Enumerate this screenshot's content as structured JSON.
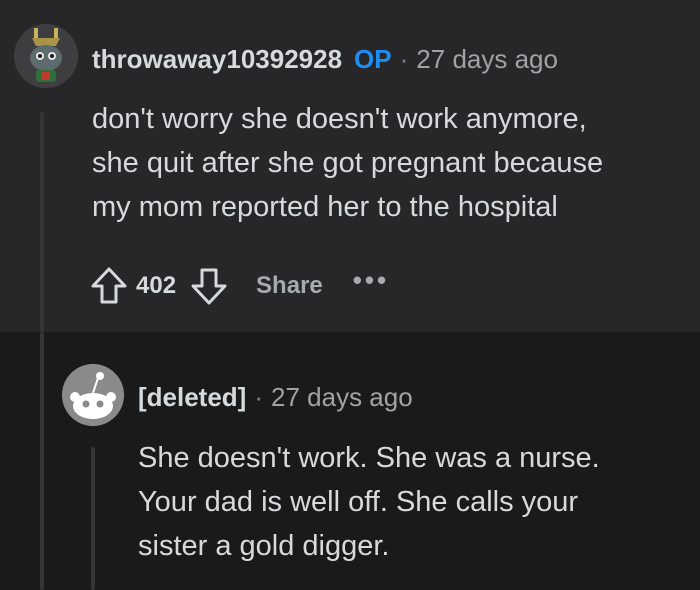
{
  "comments": [
    {
      "username": "throwaway10392928",
      "badge": "OP",
      "time": "27 days ago",
      "body": "don't worry she doesn't work anymore,\nshe quit after she got pregnant because\nmy mom reported her to the hospital",
      "score": "402",
      "share_label": "Share",
      "more_label": "•••"
    },
    {
      "username": "[deleted]",
      "time": "27 days ago",
      "body": "She doesn't work. She was a nurse.\nYour dad is well off. She calls your\nsister a gold digger."
    }
  ],
  "separator": "·",
  "icons": {
    "avatar_op": "custom-avatar-icon",
    "avatar_deleted": "default-snoo-avatar-icon",
    "upvote": "upvote-arrow-icon",
    "downvote": "downvote-arrow-icon"
  },
  "colors": {
    "background": "#1a1a1b",
    "highlight_background": "#272729",
    "op_badge": "#1f8cf2"
  }
}
